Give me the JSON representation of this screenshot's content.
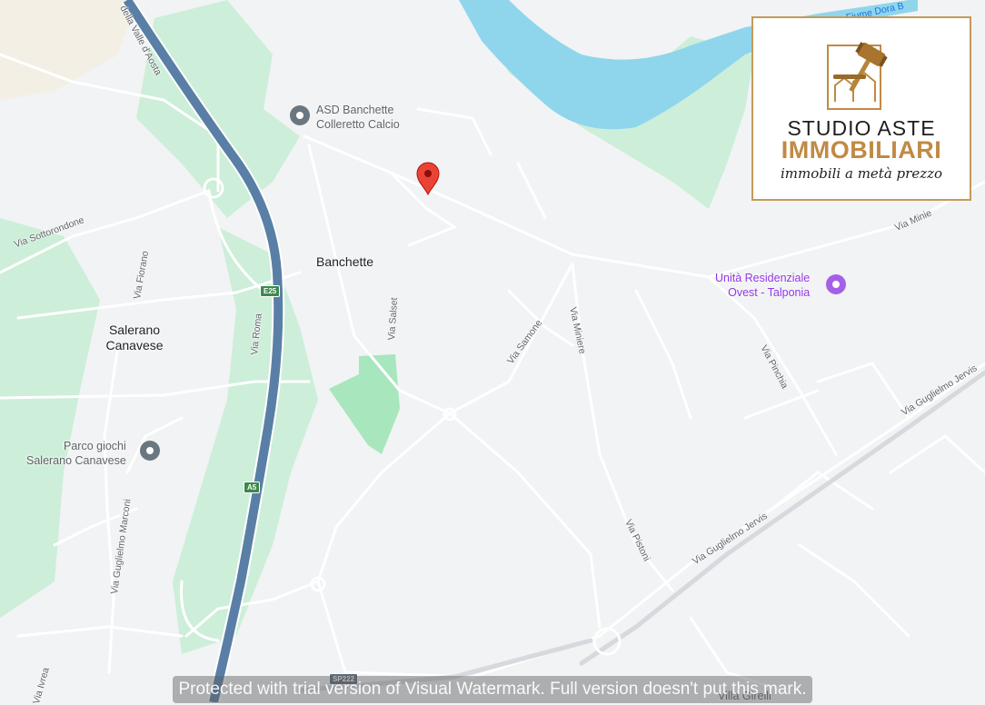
{
  "places": {
    "banchette": "Banchette",
    "salerano_1": "Salerano",
    "salerano_2": "Canavese"
  },
  "pois": {
    "asd_1": "ASD Banchette",
    "asd_2": "Colleretto Calcio",
    "unita_1": "Unità Residenziale",
    "unita_2": "Ovest - Talponia",
    "parco_1": "Parco giochi",
    "parco_2": "Salerano Canavese",
    "villa": "Villa Girelli"
  },
  "streets": {
    "valle_aosta": "della Valle d'Aosta",
    "sottorondone": "Via Sottorondone",
    "fiorano": "Via Fiorano",
    "roma": "Via Roma",
    "salset": "Via Salset",
    "samone": "Via Samone",
    "miniere": "Via Miniere",
    "pinchia": "Via Pinchia",
    "jervis_1": "Via Guglielmo Jervis",
    "jervis_2": "Via Guglielmo Jervis",
    "pistoni": "Via Pistoni",
    "marconi": "Via Guglielmo Marconi",
    "ivrea": "Via Ivrea",
    "minie_partial": "Via Minie"
  },
  "water": {
    "dora": "Fiume Dora B"
  },
  "shields": {
    "e25": "E25",
    "a5": "A5",
    "sp222": "SP222"
  },
  "logo": {
    "line1": "STUDIO ASTE",
    "line2": "IMMOBILIARI",
    "line3": "immobili a metà prezzo"
  },
  "watermark": "Protected with trial version of Visual Watermark. Full version doesn't put this mark.",
  "icons": {
    "marker": "location-pin-icon",
    "poi": "place-dot-icon",
    "hotel": "lodging-icon",
    "gavel": "gavel-icon"
  },
  "colors": {
    "land": "#f1f3f4",
    "park": "#cdeed9",
    "water": "#8fd6ec",
    "highway": "#5a7fa6",
    "road": "#ffffff",
    "marker": "#ea4335",
    "brand_gold": "#c08a45"
  }
}
